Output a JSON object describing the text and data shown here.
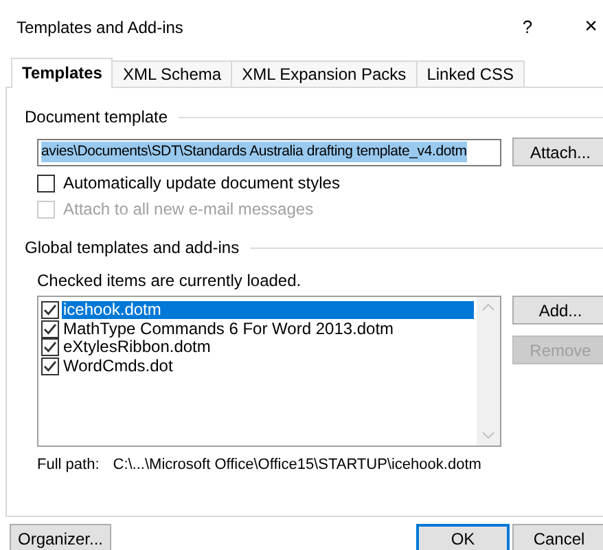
{
  "window": {
    "title": "Templates and Add-ins",
    "help": "?",
    "close": "×"
  },
  "tabs": [
    {
      "label": "Templates",
      "selected": true
    },
    {
      "label": "XML Schema",
      "selected": false
    },
    {
      "label": "XML Expansion Packs",
      "selected": false
    },
    {
      "label": "Linked CSS",
      "selected": false
    }
  ],
  "document_template": {
    "label": "Document template",
    "path": "avies\\Documents\\SDT\\Standards Australia drafting template_v4.dotm",
    "attach_button": "Attach...",
    "options": [
      {
        "label": "Automatically update document styles",
        "checked": false,
        "disabled": false
      },
      {
        "label": "Attach to all new e-mail messages",
        "checked": false,
        "disabled": true
      }
    ]
  },
  "global": {
    "label": "Global templates and add-ins",
    "hint": "Checked items are currently loaded.",
    "items": [
      {
        "name": "icehook.dotm",
        "checked": true,
        "selected": true
      },
      {
        "name": "MathType Commands 6 For Word 2013.dotm",
        "checked": true,
        "selected": false
      },
      {
        "name": "eXtylesRibbon.dotm",
        "checked": true,
        "selected": false
      },
      {
        "name": "WordCmds.dot",
        "checked": true,
        "selected": false
      }
    ],
    "buttons": [
      {
        "label": "Add...",
        "disabled": false
      },
      {
        "label": "Remove",
        "disabled": true
      }
    ],
    "full_path_label": "Full path:",
    "full_path": "C:\\...\\Microsoft Office\\Office15\\STARTUP\\icehook.dotm"
  },
  "footer_buttons": [
    {
      "label": "Organizer...",
      "default": false
    },
    {
      "label": "OK",
      "default": true
    },
    {
      "label": "Cancel",
      "default": false
    }
  ]
}
